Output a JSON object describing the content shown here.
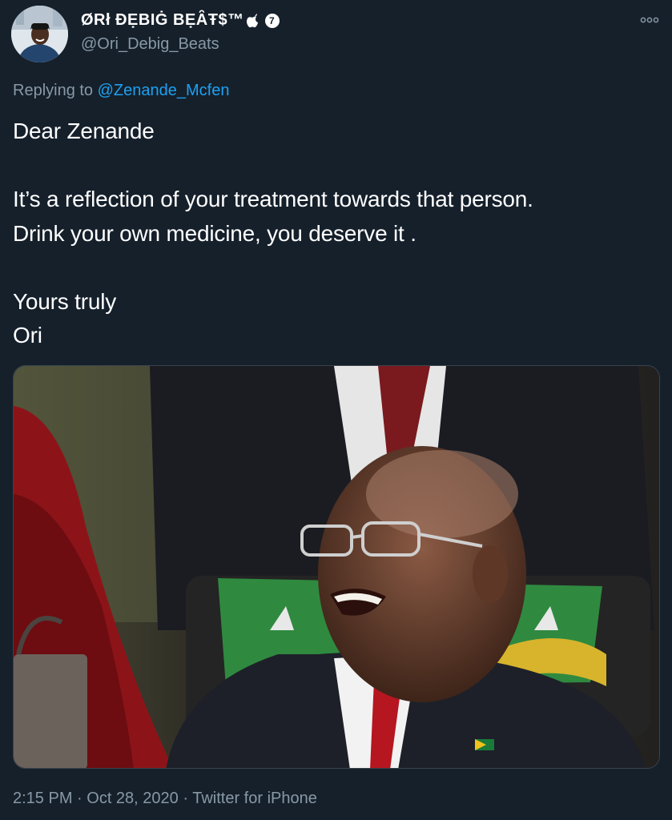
{
  "author": {
    "display_name": "ØRł ĐẸBIĠ BẸȂŦ$™",
    "badge_text": "7",
    "handle": "@Ori_Debig_Beats"
  },
  "reply": {
    "prefix": "Replying to ",
    "to_handle": "@Zenande_Mcfen"
  },
  "tweet": {
    "text": "Dear Zenande\n\nIt’s a reflection of your treatment towards that person.\nDrink your own medicine, you deserve it .\n\nYours truly\nOri"
  },
  "meta": {
    "time": "2:15 PM",
    "date": "Oct 28, 2020",
    "source": "Twitter for iPhone",
    "separator": " · "
  },
  "colors": {
    "background": "#15202b",
    "secondary_text": "#8899a6",
    "link": "#1da1f2"
  }
}
